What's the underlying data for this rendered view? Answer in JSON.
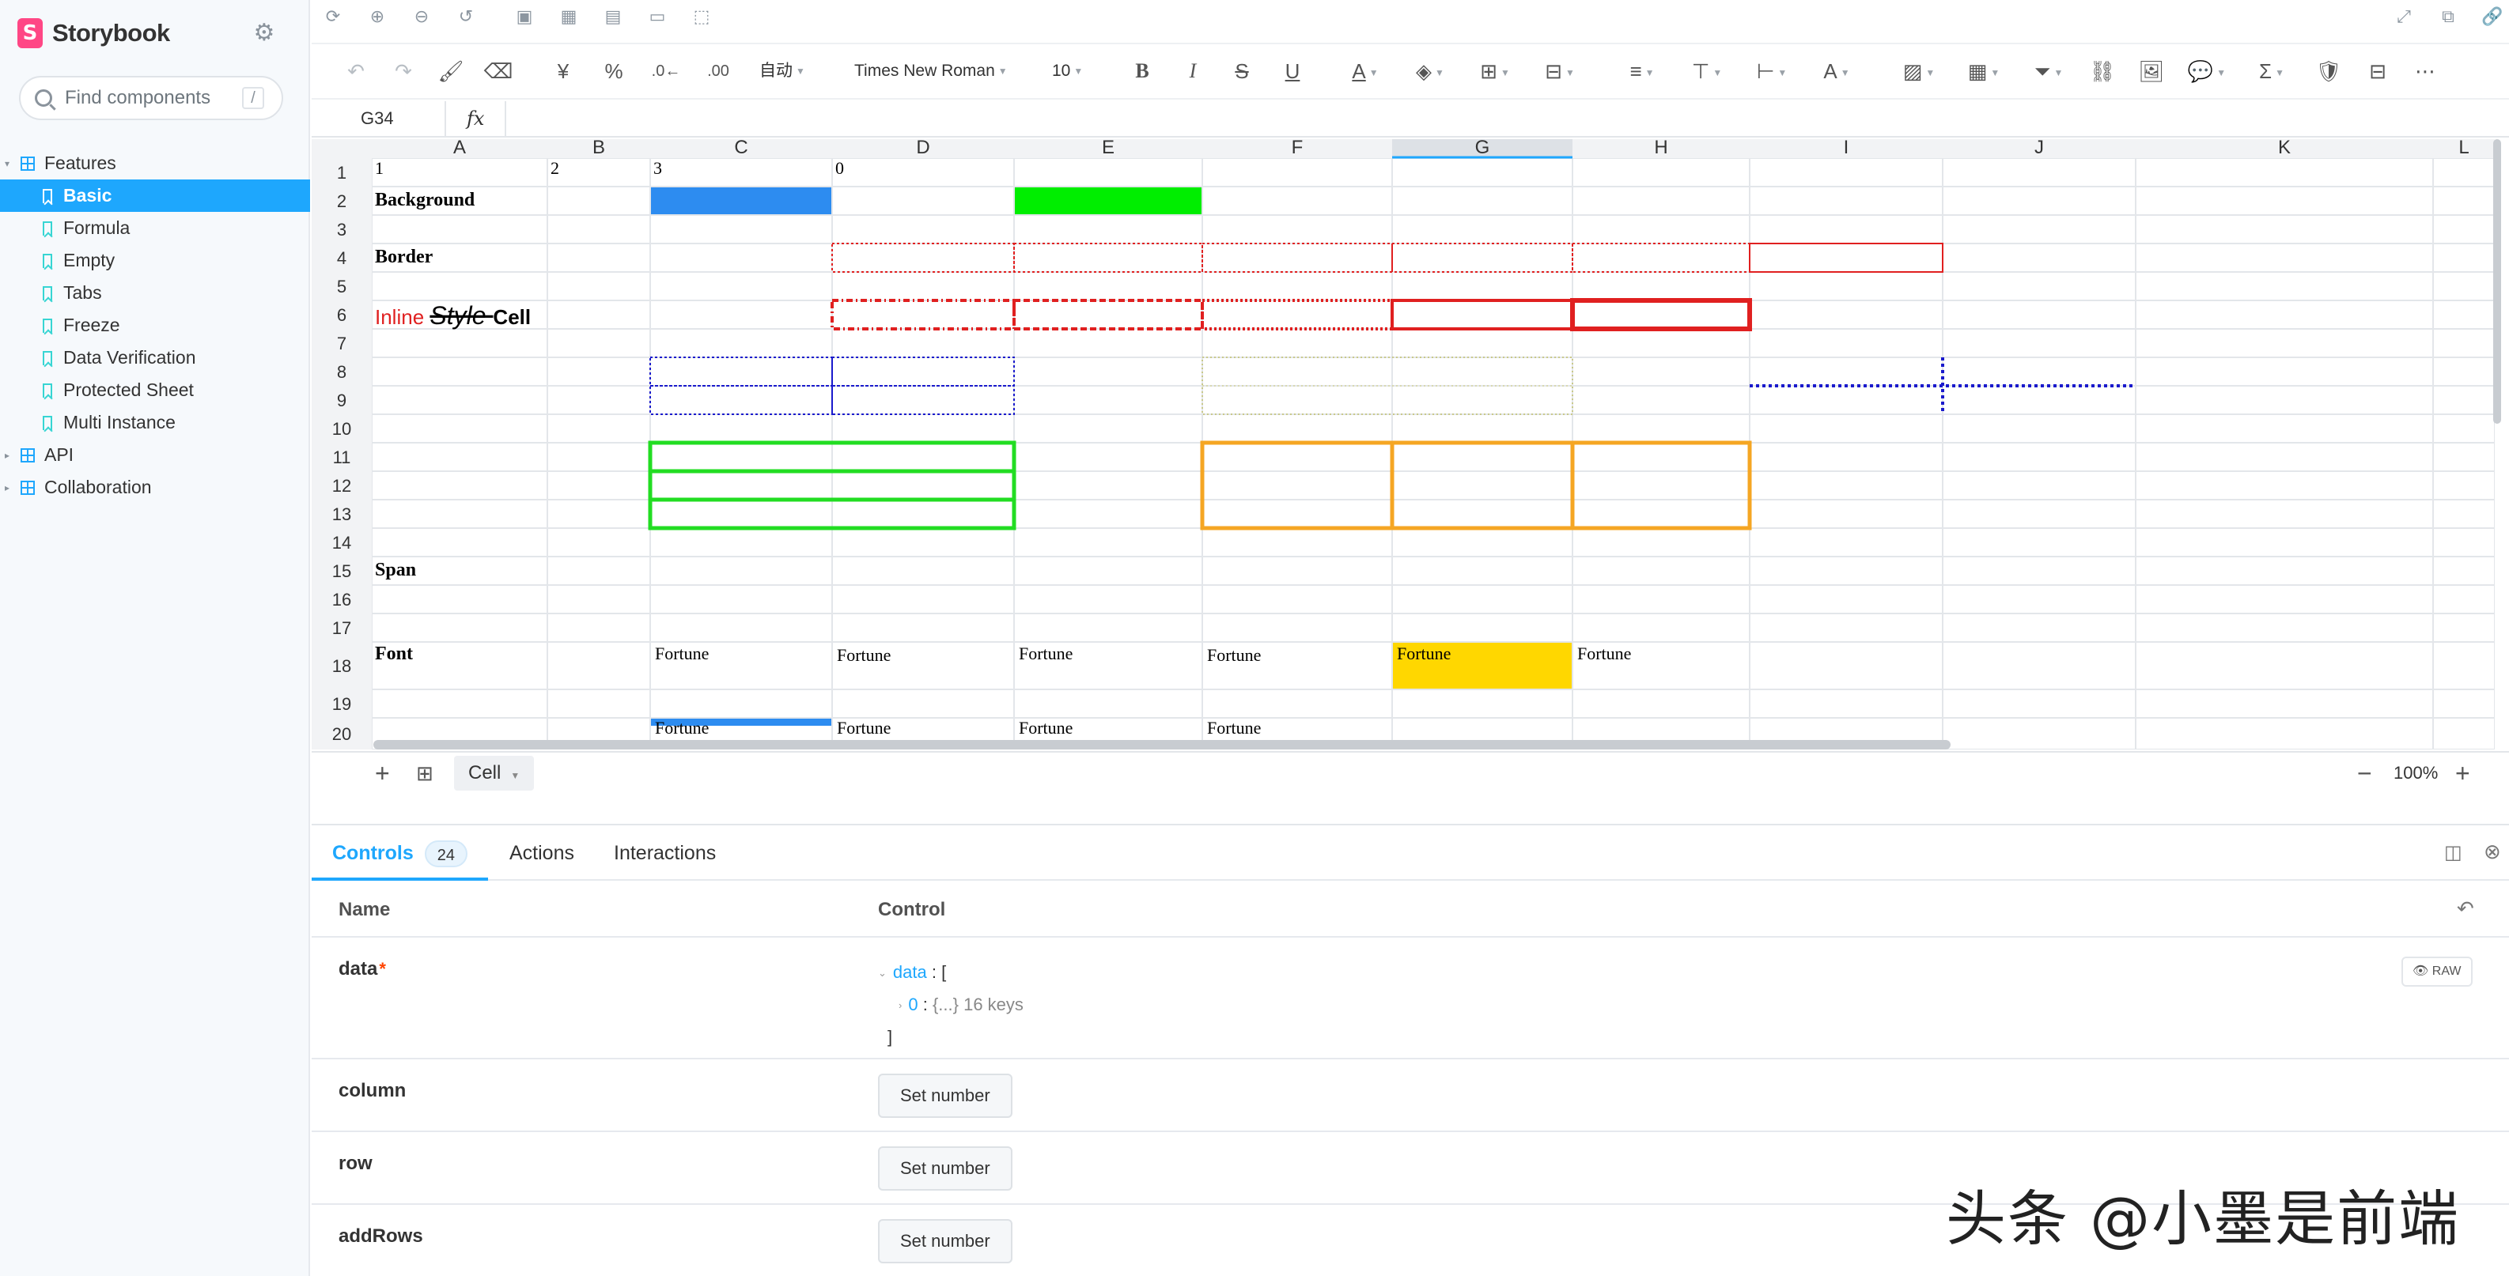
{
  "sidebar": {
    "brand": "Storybook",
    "search_placeholder": "Find components",
    "search_shortcut": "/",
    "tree": [
      {
        "label": "Features",
        "kind": "group",
        "expanded": true
      },
      {
        "label": "Basic",
        "kind": "story",
        "active": true
      },
      {
        "label": "Formula",
        "kind": "story"
      },
      {
        "label": "Empty",
        "kind": "story"
      },
      {
        "label": "Tabs",
        "kind": "story"
      },
      {
        "label": "Freeze",
        "kind": "story"
      },
      {
        "label": "Data Verification",
        "kind": "story"
      },
      {
        "label": "Protected Sheet",
        "kind": "story"
      },
      {
        "label": "Multi Instance",
        "kind": "story"
      },
      {
        "label": "API",
        "kind": "group",
        "expanded": false
      },
      {
        "label": "Collaboration",
        "kind": "group",
        "expanded": false
      }
    ]
  },
  "toolbar": {
    "format_label": "自动",
    "font_family": "Times New Roman",
    "font_size": "10"
  },
  "formula_bar": {
    "cell_ref": "G34",
    "fx": "fx",
    "value": ""
  },
  "sheet": {
    "columns": [
      "A",
      "B",
      "C",
      "D",
      "E",
      "F",
      "G",
      "H",
      "I",
      "J",
      "K",
      "L"
    ],
    "rows": [
      "1",
      "2",
      "3",
      "4",
      "5",
      "6",
      "7",
      "8",
      "9",
      "10",
      "11",
      "12",
      "13",
      "14",
      "15",
      "16",
      "17",
      "18",
      "19",
      "20"
    ],
    "selected_column": "G",
    "cells": {
      "A1": "1",
      "B1": "2",
      "C1": "3",
      "D1": "0",
      "A2": "Background",
      "A4": "Border",
      "A6_parts": [
        "Inline",
        "Style",
        "Cell"
      ],
      "A15": "Span",
      "A18": "Font",
      "font_samples": [
        "Fortune",
        "Fortune",
        "Fortune",
        "Fortune",
        "Fortune",
        "Fortune"
      ],
      "row20": [
        "Fortune",
        "Fortune",
        "Fortune",
        "Fortune"
      ]
    },
    "colors": {
      "blue_bg": "#2d8cf0",
      "green_bg": "#00ee00",
      "yellow_bg": "#ffd700",
      "border_red": "#e02020",
      "border_green": "#22dd22",
      "border_orange": "#f5a623",
      "border_blue": "#1a1acc",
      "header_bg": "#f2f3f5",
      "grid_line": "#e3e6ea"
    },
    "tab_name": "Cell",
    "zoom": "100%"
  },
  "addons": {
    "tabs": [
      {
        "label": "Controls",
        "count": "24",
        "active": true
      },
      {
        "label": "Actions"
      },
      {
        "label": "Interactions"
      }
    ],
    "header": {
      "name": "Name",
      "control": "Control"
    },
    "rows": [
      {
        "name": "data",
        "required": "*",
        "json": {
          "key": "data",
          "open": "[",
          "item_key": "0",
          "item_summary": "{...} 16 keys",
          "close": "]"
        },
        "raw": "RAW"
      },
      {
        "name": "column",
        "button": "Set number"
      },
      {
        "name": "row",
        "button": "Set number"
      },
      {
        "name": "addRows",
        "button": "Set number"
      }
    ]
  },
  "watermark": "头条 @小墨是前端"
}
